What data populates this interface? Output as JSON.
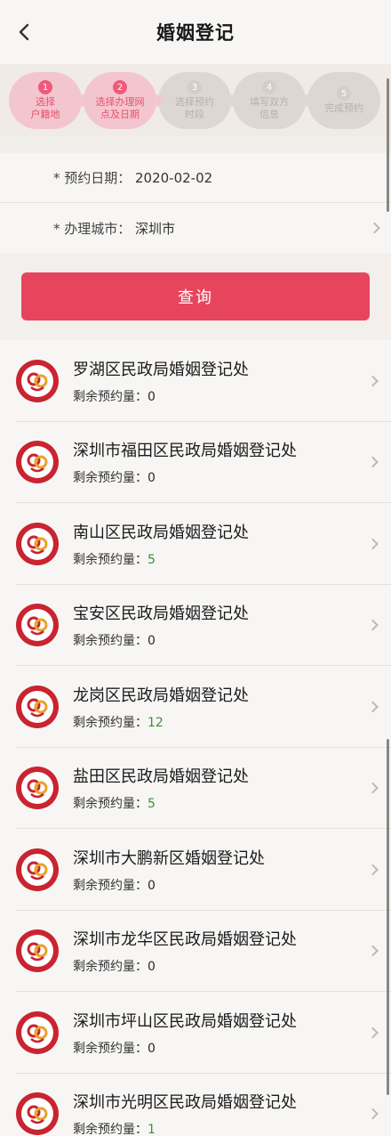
{
  "header": {
    "title": "婚姻登记"
  },
  "steps": [
    {
      "num": "1",
      "label": "选择\n户籍地",
      "active": true
    },
    {
      "num": "2",
      "label": "选择办理网\n点及日期",
      "active": true
    },
    {
      "num": "3",
      "label": "选择预约\n时段",
      "active": false
    },
    {
      "num": "4",
      "label": "填写双方\n信息",
      "active": false
    },
    {
      "num": "5",
      "label": "完成预约",
      "active": false
    }
  ],
  "form": {
    "date_label": "* 预约日期：",
    "date_value": "2020-02-02",
    "city_label": "* 办理城市：",
    "city_value": "深圳市"
  },
  "query_button": "查询",
  "remaining_label": "剩余预约量：",
  "offices": [
    {
      "name": "罗湖区民政局婚姻登记处",
      "remaining": "0"
    },
    {
      "name": "深圳市福田区民政局婚姻登记处",
      "remaining": "0"
    },
    {
      "name": "南山区民政局婚姻登记处",
      "remaining": "5"
    },
    {
      "name": "宝安区民政局婚姻登记处",
      "remaining": "0"
    },
    {
      "name": "龙岗区民政局婚姻登记处",
      "remaining": "12"
    },
    {
      "name": "盐田区民政局婚姻登记处",
      "remaining": "5"
    },
    {
      "name": "深圳市大鹏新区婚姻登记处",
      "remaining": "0"
    },
    {
      "name": "深圳市龙华区民政局婚姻登记处",
      "remaining": "0"
    },
    {
      "name": "深圳市坪山区民政局婚姻登记处",
      "remaining": "0"
    },
    {
      "name": "深圳市光明区民政局婚姻登记处",
      "remaining": "1"
    }
  ],
  "colors": {
    "accent": "#e7455e",
    "positive": "#3f8d3c"
  }
}
